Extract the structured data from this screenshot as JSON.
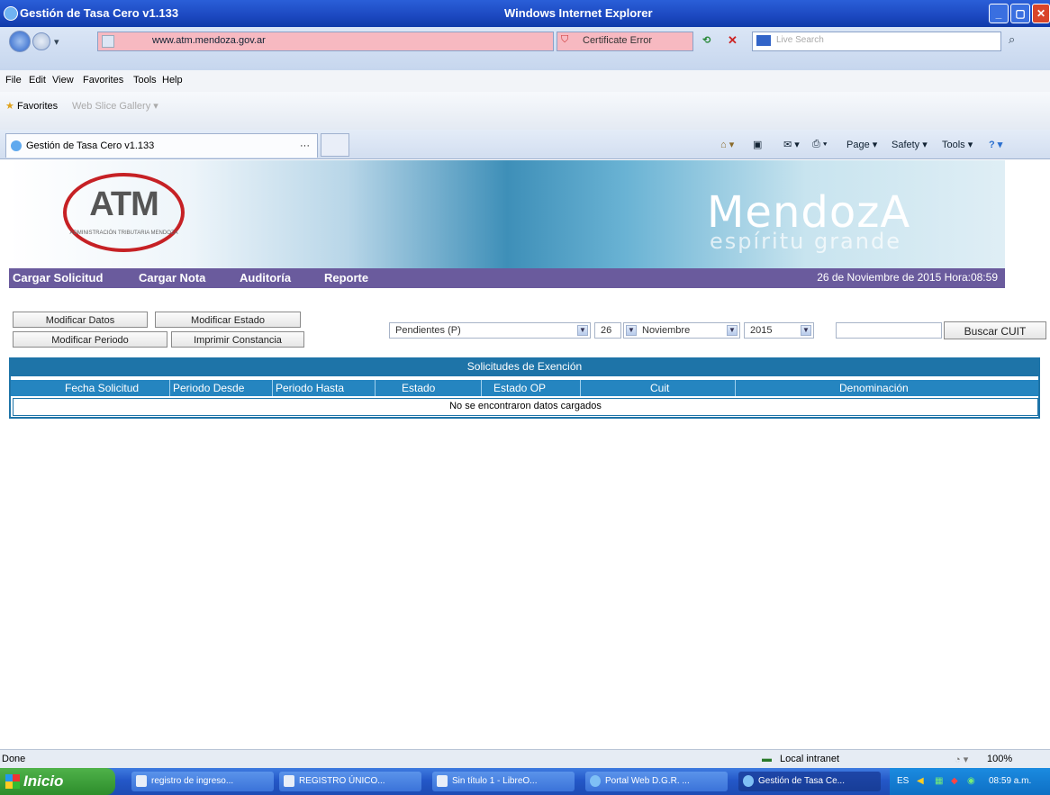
{
  "window": {
    "title": "Gestión de Tasa Cero v1.133",
    "app_name": "Windows Internet Explorer"
  },
  "address_bar": {
    "url": "www.atm.mendoza.gov.ar",
    "certificate_label": "Certificate Error",
    "search_placeholder": "Live Search"
  },
  "menu": {
    "items": [
      "File",
      "Edit",
      "View",
      "Favorites",
      "Tools",
      "Help"
    ]
  },
  "favorites_bar": {
    "favorites_label": "Favorites",
    "slice_gallery": "Web Slice Gallery ▾"
  },
  "tab": {
    "label": "Gestión de Tasa Cero v1.133",
    "close": "···"
  },
  "command_bar": {
    "page": "Page ▾",
    "safety": "Safety ▾",
    "tools": "Tools ▾"
  },
  "banner": {
    "logo_text": "ATM",
    "logo_caption": "ADMINISTRACIÓN TRIBUTARIA MENDOZA",
    "brand": "MendozA",
    "tagline": "espíritu grande"
  },
  "nav": {
    "items": [
      "Cargar Solicitud",
      "Cargar Nota",
      "Auditoría",
      "Reporte"
    ],
    "datetime": "26 de Noviembre de 2015 Hora:08:59"
  },
  "toolbar": {
    "modificar_datos": "Modificar Datos",
    "modificar_estado": "Modificar Estado",
    "modificar_periodo": "Modificar Periodo",
    "imprimir_constancia": "Imprimir Constancia",
    "estado_select": "Pendientes (P)",
    "day_select": "26",
    "month_select": "Noviembre",
    "year_select": "2015",
    "cuit_input": "",
    "buscar_cuit": "Buscar CUIT"
  },
  "grid": {
    "title": "Solicitudes de Exención",
    "columns": [
      "Fecha Solicitud",
      "Periodo Desde",
      "Periodo Hasta",
      "Estado",
      "Estado OP",
      "Cuit",
      "Denominación"
    ],
    "empty_message": "No se encontraron datos cargados"
  },
  "status_bar": {
    "status": "Done",
    "zone": "Local intranet",
    "zoom": "100%"
  },
  "taskbar": {
    "start": "Inicio",
    "tasks": [
      "registro de ingreso...",
      "REGISTRO ÚNICO...",
      "Sin título 1 - LibreO...",
      "Portal Web D.G.R. ...",
      "Gestión de Tasa Ce..."
    ],
    "language": "ES",
    "clock": "08:59 a.m."
  }
}
